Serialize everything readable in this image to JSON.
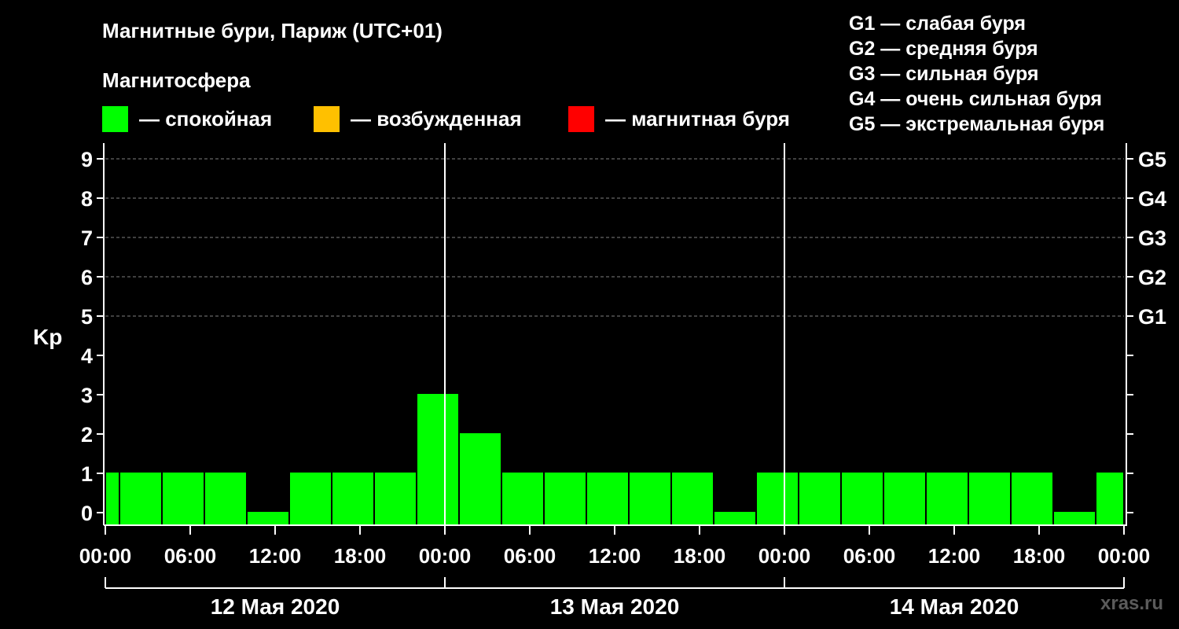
{
  "header": {
    "title": "Магнитные бури, Париж (UTC+01)",
    "subtitle": "Магнитосфера"
  },
  "legend": [
    {
      "label": "— спокойная",
      "color": "#00ff00"
    },
    {
      "label": "— возбужденная",
      "color": "#ffc000"
    },
    {
      "label": "— магнитная буря",
      "color": "#ff0000"
    }
  ],
  "g_scale": [
    "G1 — слабая буря",
    "G2 — средняя буря",
    "G3 — сильная буря",
    "G4 — очень сильная буря",
    "G5 — экстремальная буря"
  ],
  "watermark": "xras.ru",
  "chart_data": {
    "type": "bar",
    "title": "Магнитные бури, Париж (UTC+01)",
    "ylabel": "Kp",
    "ylim": [
      0,
      9
    ],
    "y_ticks": [
      "0",
      "1",
      "2",
      "3",
      "4",
      "5",
      "6",
      "7",
      "8",
      "9"
    ],
    "right_ticks": [
      {
        "kp": 5,
        "label": "G1"
      },
      {
        "kp": 6,
        "label": "G2"
      },
      {
        "kp": 7,
        "label": "G3"
      },
      {
        "kp": 8,
        "label": "G4"
      },
      {
        "kp": 9,
        "label": "G5"
      }
    ],
    "x_range_hours": [
      0,
      72
    ],
    "x_tick_labels": [
      "00:00",
      "06:00",
      "12:00",
      "18:00",
      "00:00",
      "06:00",
      "12:00",
      "18:00",
      "00:00",
      "06:00",
      "12:00",
      "18:00",
      "00:00"
    ],
    "days": [
      "12 Мая 2020",
      "13 Мая 2020",
      "14 Мая 2020"
    ],
    "grid": true,
    "bars": [
      {
        "start": 0,
        "end": 1,
        "kp": 1
      },
      {
        "start": 1,
        "end": 4,
        "kp": 1
      },
      {
        "start": 4,
        "end": 7,
        "kp": 1
      },
      {
        "start": 7,
        "end": 10,
        "kp": 1
      },
      {
        "start": 10,
        "end": 13,
        "kp": 0
      },
      {
        "start": 13,
        "end": 16,
        "kp": 1
      },
      {
        "start": 16,
        "end": 19,
        "kp": 1
      },
      {
        "start": 19,
        "end": 22,
        "kp": 1
      },
      {
        "start": 22,
        "end": 25,
        "kp": 3
      },
      {
        "start": 25,
        "end": 28,
        "kp": 2
      },
      {
        "start": 28,
        "end": 31,
        "kp": 1
      },
      {
        "start": 31,
        "end": 34,
        "kp": 1
      },
      {
        "start": 34,
        "end": 37,
        "kp": 1
      },
      {
        "start": 37,
        "end": 40,
        "kp": 1
      },
      {
        "start": 40,
        "end": 43,
        "kp": 1
      },
      {
        "start": 43,
        "end": 46,
        "kp": 0
      },
      {
        "start": 46,
        "end": 49,
        "kp": 1
      },
      {
        "start": 49,
        "end": 52,
        "kp": 1
      },
      {
        "start": 52,
        "end": 55,
        "kp": 1
      },
      {
        "start": 55,
        "end": 58,
        "kp": 1
      },
      {
        "start": 58,
        "end": 61,
        "kp": 1
      },
      {
        "start": 61,
        "end": 64,
        "kp": 1
      },
      {
        "start": 64,
        "end": 67,
        "kp": 1
      },
      {
        "start": 67,
        "end": 70,
        "kp": 0
      },
      {
        "start": 70,
        "end": 72,
        "kp": 1
      }
    ],
    "colors": {
      "quiet": "#00ff00",
      "excited": "#ffc000",
      "storm": "#ff0000",
      "axis": "#ffffff",
      "grid": "#808080"
    }
  }
}
